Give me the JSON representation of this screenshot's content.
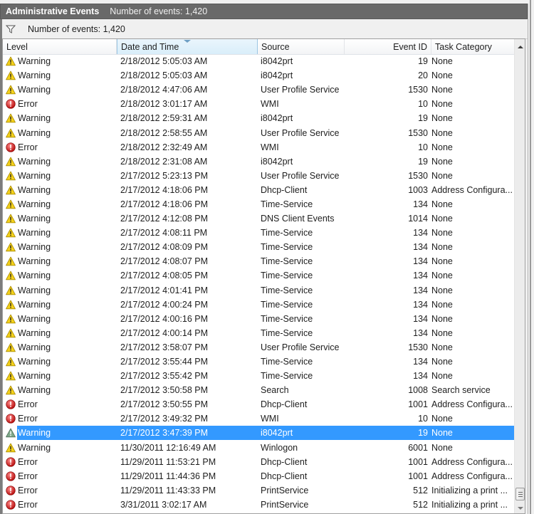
{
  "title_bar": {
    "name": "Administrative Events",
    "count_text": "Number of events: 1,420"
  },
  "filter_bar": {
    "icon": "filter-icon",
    "text": "Number of events: 1,420"
  },
  "columns": [
    {
      "key": "level",
      "label": "Level"
    },
    {
      "key": "date",
      "label": "Date and Time",
      "sorted": "descending"
    },
    {
      "key": "source",
      "label": "Source"
    },
    {
      "key": "event_id",
      "label": "Event ID"
    },
    {
      "key": "task",
      "label": "Task Category"
    }
  ],
  "colors": {
    "selection": "#3399ff",
    "warning": "#f5d21a",
    "error": "#d42020",
    "title_bar": "#696969"
  },
  "events": [
    {
      "level": "Warning",
      "icon": "warning-icon",
      "date": "2/18/2012 5:05:03 AM",
      "source": "i8042prt",
      "event_id": "19",
      "task": "None"
    },
    {
      "level": "Warning",
      "icon": "warning-icon",
      "date": "2/18/2012 5:05:03 AM",
      "source": "i8042prt",
      "event_id": "20",
      "task": "None"
    },
    {
      "level": "Warning",
      "icon": "warning-icon",
      "date": "2/18/2012 4:47:06 AM",
      "source": "User Profile Service",
      "event_id": "1530",
      "task": "None"
    },
    {
      "level": "Error",
      "icon": "error-icon",
      "date": "2/18/2012 3:01:17 AM",
      "source": "WMI",
      "event_id": "10",
      "task": "None"
    },
    {
      "level": "Warning",
      "icon": "warning-icon",
      "date": "2/18/2012 2:59:31 AM",
      "source": "i8042prt",
      "event_id": "19",
      "task": "None"
    },
    {
      "level": "Warning",
      "icon": "warning-icon",
      "date": "2/18/2012 2:58:55 AM",
      "source": "User Profile Service",
      "event_id": "1530",
      "task": "None"
    },
    {
      "level": "Error",
      "icon": "error-icon",
      "date": "2/18/2012 2:32:49 AM",
      "source": "WMI",
      "event_id": "10",
      "task": "None"
    },
    {
      "level": "Warning",
      "icon": "warning-icon",
      "date": "2/18/2012 2:31:08 AM",
      "source": "i8042prt",
      "event_id": "19",
      "task": "None"
    },
    {
      "level": "Warning",
      "icon": "warning-icon",
      "date": "2/17/2012 5:23:13 PM",
      "source": "User Profile Service",
      "event_id": "1530",
      "task": "None"
    },
    {
      "level": "Warning",
      "icon": "warning-icon",
      "date": "2/17/2012 4:18:06 PM",
      "source": "Dhcp-Client",
      "event_id": "1003",
      "task": "Address Configura..."
    },
    {
      "level": "Warning",
      "icon": "warning-icon",
      "date": "2/17/2012 4:18:06 PM",
      "source": "Time-Service",
      "event_id": "134",
      "task": "None"
    },
    {
      "level": "Warning",
      "icon": "warning-icon",
      "date": "2/17/2012 4:12:08 PM",
      "source": "DNS Client Events",
      "event_id": "1014",
      "task": "None"
    },
    {
      "level": "Warning",
      "icon": "warning-icon",
      "date": "2/17/2012 4:08:11 PM",
      "source": "Time-Service",
      "event_id": "134",
      "task": "None"
    },
    {
      "level": "Warning",
      "icon": "warning-icon",
      "date": "2/17/2012 4:08:09 PM",
      "source": "Time-Service",
      "event_id": "134",
      "task": "None"
    },
    {
      "level": "Warning",
      "icon": "warning-icon",
      "date": "2/17/2012 4:08:07 PM",
      "source": "Time-Service",
      "event_id": "134",
      "task": "None"
    },
    {
      "level": "Warning",
      "icon": "warning-icon",
      "date": "2/17/2012 4:08:05 PM",
      "source": "Time-Service",
      "event_id": "134",
      "task": "None"
    },
    {
      "level": "Warning",
      "icon": "warning-icon",
      "date": "2/17/2012 4:01:41 PM",
      "source": "Time-Service",
      "event_id": "134",
      "task": "None"
    },
    {
      "level": "Warning",
      "icon": "warning-icon",
      "date": "2/17/2012 4:00:24 PM",
      "source": "Time-Service",
      "event_id": "134",
      "task": "None"
    },
    {
      "level": "Warning",
      "icon": "warning-icon",
      "date": "2/17/2012 4:00:16 PM",
      "source": "Time-Service",
      "event_id": "134",
      "task": "None"
    },
    {
      "level": "Warning",
      "icon": "warning-icon",
      "date": "2/17/2012 4:00:14 PM",
      "source": "Time-Service",
      "event_id": "134",
      "task": "None"
    },
    {
      "level": "Warning",
      "icon": "warning-icon",
      "date": "2/17/2012 3:58:07 PM",
      "source": "User Profile Service",
      "event_id": "1530",
      "task": "None"
    },
    {
      "level": "Warning",
      "icon": "warning-icon",
      "date": "2/17/2012 3:55:44 PM",
      "source": "Time-Service",
      "event_id": "134",
      "task": "None"
    },
    {
      "level": "Warning",
      "icon": "warning-icon",
      "date": "2/17/2012 3:55:42 PM",
      "source": "Time-Service",
      "event_id": "134",
      "task": "None"
    },
    {
      "level": "Warning",
      "icon": "warning-icon",
      "date": "2/17/2012 3:50:58 PM",
      "source": "Search",
      "event_id": "1008",
      "task": "Search service"
    },
    {
      "level": "Error",
      "icon": "error-icon",
      "date": "2/17/2012 3:50:55 PM",
      "source": "Dhcp-Client",
      "event_id": "1001",
      "task": "Address Configura..."
    },
    {
      "level": "Error",
      "icon": "error-icon",
      "date": "2/17/2012 3:49:32 PM",
      "source": "WMI",
      "event_id": "10",
      "task": "None"
    },
    {
      "level": "Warning",
      "icon": "warning-icon",
      "date": "2/17/2012 3:47:39 PM",
      "source": "i8042prt",
      "event_id": "19",
      "task": "None",
      "selected": true
    },
    {
      "level": "Warning",
      "icon": "warning-icon",
      "date": "11/30/2011 12:16:49 AM",
      "source": "Winlogon",
      "event_id": "6001",
      "task": "None"
    },
    {
      "level": "Error",
      "icon": "error-icon",
      "date": "11/29/2011 11:53:21 PM",
      "source": "Dhcp-Client",
      "event_id": "1001",
      "task": "Address Configura..."
    },
    {
      "level": "Error",
      "icon": "error-icon",
      "date": "11/29/2011 11:44:36 PM",
      "source": "Dhcp-Client",
      "event_id": "1001",
      "task": "Address Configura..."
    },
    {
      "level": "Error",
      "icon": "error-icon",
      "date": "11/29/2011 11:43:33 PM",
      "source": "PrintService",
      "event_id": "512",
      "task": "Initializing a print ..."
    },
    {
      "level": "Error",
      "icon": "error-icon",
      "date": "3/31/2011 3:02:17 AM",
      "source": "PrintService",
      "event_id": "512",
      "task": "Initializing a print ..."
    }
  ],
  "scrollbar": {
    "position_fraction": 0.98
  }
}
